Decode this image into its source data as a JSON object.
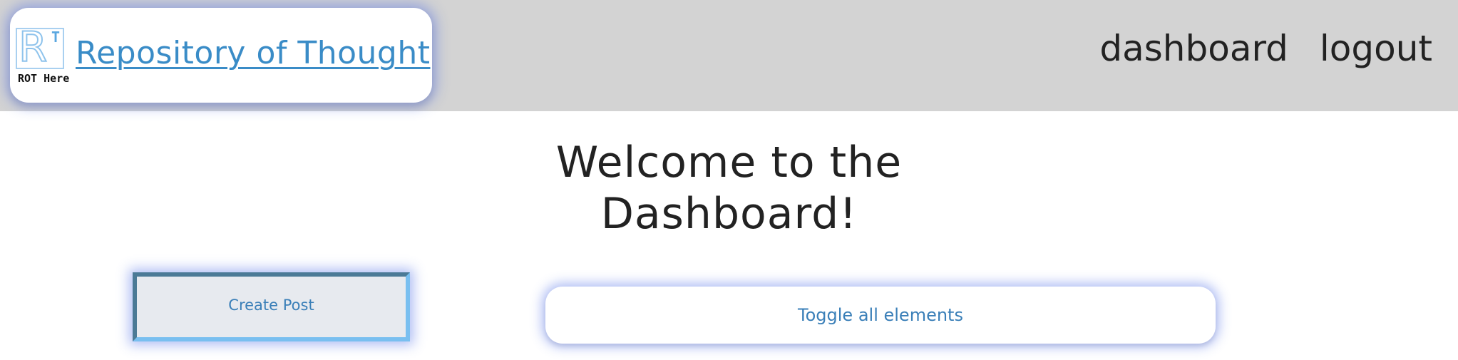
{
  "header": {
    "logo": {
      "glyph": "R",
      "superscript": "T",
      "caption": "ROT Here",
      "icon": "rot-logo-icon"
    },
    "site_title": "Repository of Thought",
    "nav": {
      "dashboard": "dashboard",
      "logout": "logout"
    }
  },
  "main": {
    "welcome_line1": "Welcome to the",
    "welcome_line2": "Dashboard!",
    "create_post_label": "Create Post",
    "toggle_all_label": "Toggle all elements"
  },
  "colors": {
    "topbar": "#d3d3d3",
    "link_blue": "#3a8cc7",
    "glow": "#5070e6",
    "button_bg": "#e7eaef"
  }
}
